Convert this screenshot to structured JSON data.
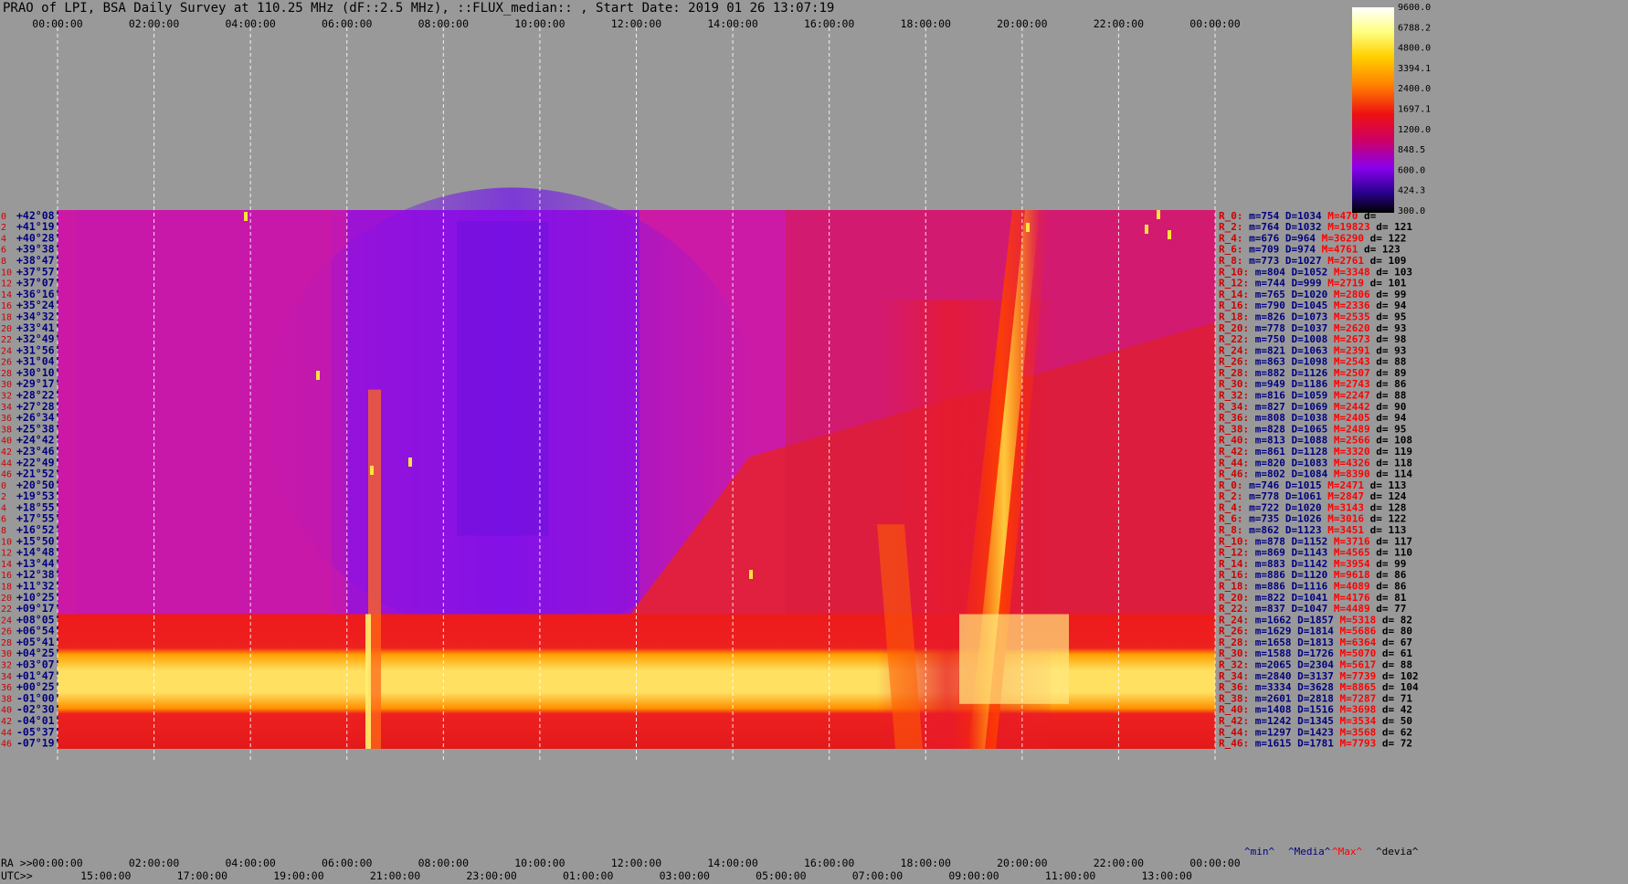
{
  "title": "PRAO of LPI, BSA Daily Survey at 110.25 MHz (dF::2.5 MHz), ::FLUX_median:: , Start Date: 2019 01 26 13:07:19",
  "chart_data": {
    "type": "heatmap",
    "ra_ticks": [
      "00:00:00",
      "02:00:00",
      "04:00:00",
      "06:00:00",
      "08:00:00",
      "10:00:00",
      "12:00:00",
      "14:00:00",
      "16:00:00",
      "18:00:00",
      "20:00:00",
      "22:00:00",
      "00:00:00"
    ],
    "utc_ticks": [
      "15:00:00",
      "17:00:00",
      "19:00:00",
      "21:00:00",
      "23:00:00",
      "01:00:00",
      "03:00:00",
      "05:00:00",
      "07:00:00",
      "09:00:00",
      "11:00:00",
      "13:00:00"
    ],
    "bottom_left_ra": "RA >>",
    "bottom_left_utc": "UTC>>",
    "row_index_labels": [
      "0",
      "2",
      "4",
      "6",
      "8",
      "10",
      "12",
      "14",
      "16",
      "18",
      "20",
      "22",
      "24",
      "26",
      "28",
      "30",
      "32",
      "34",
      "36",
      "38",
      "40",
      "42",
      "44",
      "46",
      "0",
      "2",
      "4",
      "6",
      "8",
      "10",
      "12",
      "14",
      "16",
      "18",
      "20",
      "22",
      "24",
      "26",
      "28",
      "30",
      "32",
      "34",
      "36",
      "38",
      "40",
      "42",
      "44",
      "46"
    ],
    "declinations": [
      "+42°08'",
      "+41°19'",
      "+40°28'",
      "+39°38'",
      "+38°47'",
      "+37°57'",
      "+37°07'",
      "+36°16'",
      "+35°24'",
      "+34°32'",
      "+33°41'",
      "+32°49'",
      "+31°56'",
      "+31°04'",
      "+30°10'",
      "+29°17'",
      "+28°22'",
      "+27°28'",
      "+26°34'",
      "+25°38'",
      "+24°42'",
      "+23°46'",
      "+22°49'",
      "+21°52'",
      "+20°50'",
      "+19°53'",
      "+18°55'",
      "+17°55'",
      "+16°52'",
      "+15°50'",
      "+14°48'",
      "+13°44'",
      "+12°38'",
      "+11°32'",
      "+10°25'",
      "+09°17'",
      "+08°05'",
      "+06°54'",
      "+05°41'",
      "+04°25'",
      "+03°07'",
      "+01°47'",
      "+00°25'",
      "-01°00'",
      "-02°30'",
      "-04°01'",
      "-05°37'",
      "-07°19'"
    ],
    "stats_rows": [
      {
        "r": "R_0:",
        "m": "754",
        "D": "1034",
        "M": "470",
        "d": "d="
      },
      {
        "r": "R_2:",
        "m": "764",
        "D": "1032",
        "M": "19823",
        "d": "d= 121"
      },
      {
        "r": "R_4:",
        "m": "676",
        "D": "964",
        "M": "36290",
        "d": "d= 122"
      },
      {
        "r": "R_6:",
        "m": "709",
        "D": "974",
        "M": "4761",
        "d": "d= 123"
      },
      {
        "r": "R_8:",
        "m": "773",
        "D": "1027",
        "M": "2761",
        "d": "d= 109"
      },
      {
        "r": "R_10:",
        "m": "804",
        "D": "1052",
        "M": "3348",
        "d": "d= 103"
      },
      {
        "r": "R_12:",
        "m": "744",
        "D": "999",
        "M": "2719",
        "d": "d= 101"
      },
      {
        "r": "R_14:",
        "m": "765",
        "D": "1020",
        "M": "2806",
        "d": "d= 99"
      },
      {
        "r": "R_16:",
        "m": "790",
        "D": "1045",
        "M": "2336",
        "d": "d= 94"
      },
      {
        "r": "R_18:",
        "m": "826",
        "D": "1073",
        "M": "2535",
        "d": "d= 95"
      },
      {
        "r": "R_20:",
        "m": "778",
        "D": "1037",
        "M": "2620",
        "d": "d= 93"
      },
      {
        "r": "R_22:",
        "m": "750",
        "D": "1008",
        "M": "2673",
        "d": "d= 98"
      },
      {
        "r": "R_24:",
        "m": "821",
        "D": "1063",
        "M": "2391",
        "d": "d= 93"
      },
      {
        "r": "R_26:",
        "m": "863",
        "D": "1098",
        "M": "2543",
        "d": "d= 88"
      },
      {
        "r": "R_28:",
        "m": "882",
        "D": "1126",
        "M": "2507",
        "d": "d= 89"
      },
      {
        "r": "R_30:",
        "m": "949",
        "D": "1186",
        "M": "2743",
        "d": "d= 86"
      },
      {
        "r": "R_32:",
        "m": "816",
        "D": "1059",
        "M": "2247",
        "d": "d= 88"
      },
      {
        "r": "R_34:",
        "m": "827",
        "D": "1069",
        "M": "2442",
        "d": "d= 90"
      },
      {
        "r": "R_36:",
        "m": "808",
        "D": "1038",
        "M": "2405",
        "d": "d= 94"
      },
      {
        "r": "R_38:",
        "m": "828",
        "D": "1065",
        "M": "2489",
        "d": "d= 95"
      },
      {
        "r": "R_40:",
        "m": "813",
        "D": "1088",
        "M": "2566",
        "d": "d= 108"
      },
      {
        "r": "R_42:",
        "m": "861",
        "D": "1128",
        "M": "3320",
        "d": "d= 119"
      },
      {
        "r": "R_44:",
        "m": "820",
        "D": "1083",
        "M": "4326",
        "d": "d= 118"
      },
      {
        "r": "R_46:",
        "m": "802",
        "D": "1084",
        "M": "8390",
        "d": "d= 114"
      },
      {
        "r": "R_0:",
        "m": "746",
        "D": "1015",
        "M": "2471",
        "d": "d= 113"
      },
      {
        "r": "R_2:",
        "m": "778",
        "D": "1061",
        "M": "2847",
        "d": "d= 124"
      },
      {
        "r": "R_4:",
        "m": "722",
        "D": "1020",
        "M": "3143",
        "d": "d= 128"
      },
      {
        "r": "R_6:",
        "m": "735",
        "D": "1026",
        "M": "3016",
        "d": "d= 122"
      },
      {
        "r": "R_8:",
        "m": "862",
        "D": "1123",
        "M": "3451",
        "d": "d= 113"
      },
      {
        "r": "R_10:",
        "m": "878",
        "D": "1152",
        "M": "3716",
        "d": "d= 117"
      },
      {
        "r": "R_12:",
        "m": "869",
        "D": "1143",
        "M": "4565",
        "d": "d= 110"
      },
      {
        "r": "R_14:",
        "m": "883",
        "D": "1142",
        "M": "3954",
        "d": "d= 99"
      },
      {
        "r": "R_16:",
        "m": "886",
        "D": "1120",
        "M": "9618",
        "d": "d= 86"
      },
      {
        "r": "R_18:",
        "m": "886",
        "D": "1116",
        "M": "4089",
        "d": "d= 86"
      },
      {
        "r": "R_20:",
        "m": "822",
        "D": "1041",
        "M": "4176",
        "d": "d= 81"
      },
      {
        "r": "R_22:",
        "m": "837",
        "D": "1047",
        "M": "4489",
        "d": "d= 77"
      },
      {
        "r": "R_24:",
        "m": "1662",
        "D": "1857",
        "M": "5318",
        "d": "d= 82"
      },
      {
        "r": "R_26:",
        "m": "1629",
        "D": "1814",
        "M": "5686",
        "d": "d= 80"
      },
      {
        "r": "R_28:",
        "m": "1658",
        "D": "1813",
        "M": "6364",
        "d": "d= 67"
      },
      {
        "r": "R_30:",
        "m": "1588",
        "D": "1726",
        "M": "5070",
        "d": "d= 61"
      },
      {
        "r": "R_32:",
        "m": "2065",
        "D": "2304",
        "M": "5617",
        "d": "d= 88"
      },
      {
        "r": "R_34:",
        "m": "2840",
        "D": "3137",
        "M": "7739",
        "d": "d= 102"
      },
      {
        "r": "R_36:",
        "m": "3334",
        "D": "3628",
        "M": "8865",
        "d": "d= 104"
      },
      {
        "r": "R_38:",
        "m": "2601",
        "D": "2818",
        "M": "7287",
        "d": "d= 71"
      },
      {
        "r": "R_40:",
        "m": "1408",
        "D": "1516",
        "M": "3698",
        "d": "d= 42"
      },
      {
        "r": "R_42:",
        "m": "1242",
        "D": "1345",
        "M": "3534",
        "d": "d= 50"
      },
      {
        "r": "R_44:",
        "m": "1297",
        "D": "1423",
        "M": "3568",
        "d": "d= 62"
      },
      {
        "r": "R_46:",
        "m": "1615",
        "D": "1781",
        "M": "7793",
        "d": "d= 72"
      }
    ],
    "stats_legend": [
      "^min^",
      "^Media^",
      "^Max^",
      "^devia^"
    ],
    "colorbar_ticks": [
      "9600.0",
      "6788.2",
      "4800.0",
      "3394.1",
      "2400.0",
      "1697.1",
      "1200.0",
      "848.5",
      "600.0",
      "424.3",
      "300.0"
    ],
    "colorbar_values": [
      9600,
      6788.2,
      4800,
      3394.1,
      2400,
      1697.1,
      1200,
      848.5,
      600,
      424.3,
      300
    ],
    "colors": {
      "background": "#999999",
      "dec_label": "#000080",
      "row_index": "#cc0000",
      "stat_r": "#cc0000",
      "stat_m": "#000080",
      "stat_M": "#ff0000",
      "stat_d": "#000000",
      "axis_text": "#000000",
      "gridline": "#ffffff"
    }
  }
}
